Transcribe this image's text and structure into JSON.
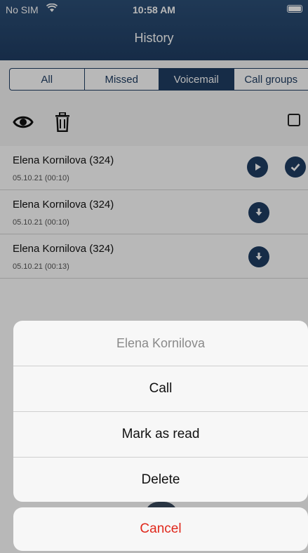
{
  "status_bar": {
    "carrier": "No SIM",
    "time": "10:58 AM",
    "icons": [
      "wifi-icon",
      "battery-icon"
    ]
  },
  "header": {
    "title": "History"
  },
  "tabs": [
    {
      "label": "All",
      "active": false
    },
    {
      "label": "Missed",
      "active": false
    },
    {
      "label": "Voicemail",
      "active": true
    },
    {
      "label": "Call groups",
      "active": false
    }
  ],
  "toolbar": {
    "icons": [
      "eye-icon",
      "trash-icon",
      "select-all-checkbox"
    ]
  },
  "voicemails": [
    {
      "name": "Elena Kornilova (324)",
      "date": "05.10.21 (00:10)",
      "actions": [
        "play-icon",
        "checkmark-icon"
      ]
    },
    {
      "name": "Elena Kornilova (324)",
      "date": "05.10.21 (00:10)",
      "actions": [
        "download-icon"
      ]
    },
    {
      "name": "Elena Kornilova (324)",
      "date": "05.10.21 (00:13)",
      "actions": [
        "download-icon"
      ]
    }
  ],
  "action_sheet": {
    "title": "Elena Kornilova",
    "items": [
      "Call",
      "Mark as read",
      "Delete"
    ],
    "cancel": "Cancel"
  },
  "colors": {
    "header": "#1f3d63",
    "accent": "#1f3d63",
    "destructive": "#e0281c"
  }
}
